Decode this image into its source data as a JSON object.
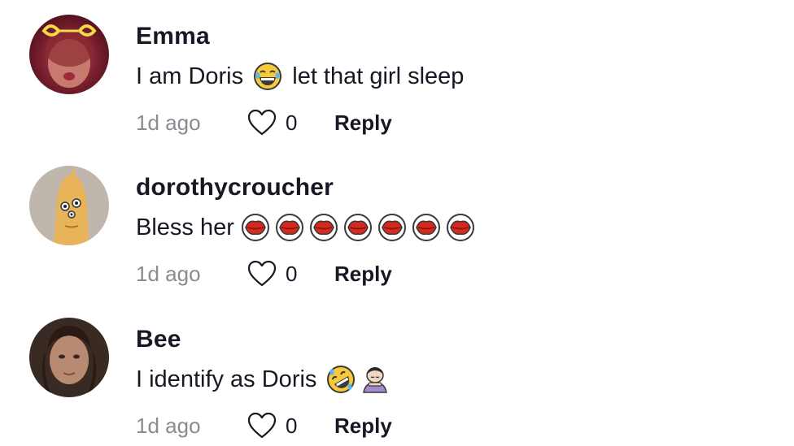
{
  "comments": [
    {
      "username": "Emma",
      "text_before": "I am Doris ",
      "text_after": " let that girl sleep",
      "emojis": [
        "laughing-tears-emoji"
      ],
      "timestamp": "1d ago",
      "likes": "0",
      "reply_label": "Reply"
    },
    {
      "username": "dorothycroucher",
      "text_before": "Bless her ",
      "text_after": "",
      "emojis": [
        "kiss-mark-emoji",
        "kiss-mark-emoji",
        "kiss-mark-emoji",
        "kiss-mark-emoji",
        "kiss-mark-emoji",
        "kiss-mark-emoji",
        "kiss-mark-emoji"
      ],
      "timestamp": "1d ago",
      "likes": "0",
      "reply_label": "Reply"
    },
    {
      "username": "Bee",
      "text_before": "I identify as Doris ",
      "text_after": "",
      "emojis": [
        "rolling-on-floor-laughing-emoji",
        "person-bowing-emoji"
      ],
      "timestamp": "1d ago",
      "likes": "0",
      "reply_label": "Reply"
    }
  ],
  "icons": {
    "like": "heart-outline-icon"
  },
  "colors": {
    "username": "#161823",
    "timestamp": "#8a8b91",
    "kiss_red": "#d62a1e"
  }
}
